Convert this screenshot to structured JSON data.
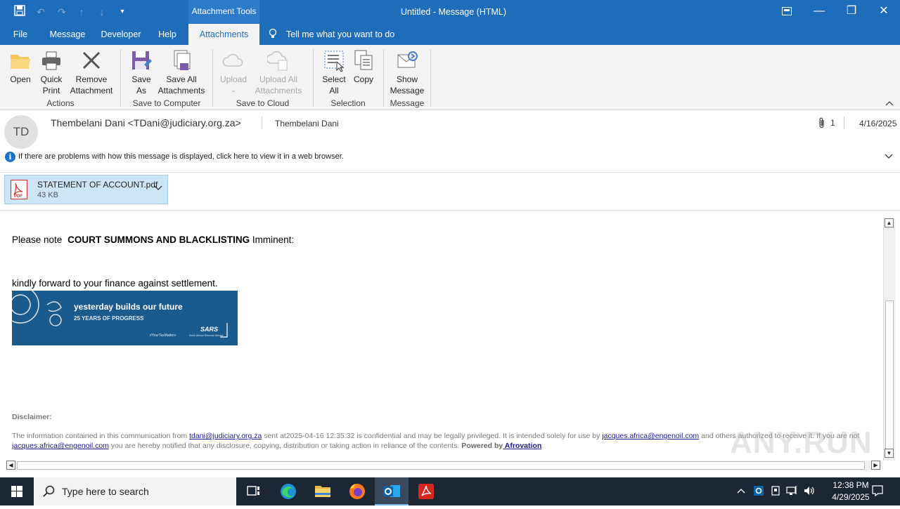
{
  "window": {
    "title": "Untitled  -  Message (HTML)",
    "context_tab_header": "Attachment Tools"
  },
  "menu": {
    "tabs": [
      {
        "label": "File"
      },
      {
        "label": "Message"
      },
      {
        "label": "Developer"
      },
      {
        "label": "Help"
      },
      {
        "label": "Attachments"
      }
    ],
    "tell_me": "Tell me what you want to do"
  },
  "ribbon": {
    "open": "Open",
    "quick_print": [
      "Quick",
      "Print"
    ],
    "remove_attachment": [
      "Remove",
      "Attachment"
    ],
    "group_actions": "Actions",
    "save_as": [
      "Save",
      "As"
    ],
    "save_all": [
      "Save All",
      "Attachments"
    ],
    "group_save_computer": "Save to Computer",
    "upload": "Upload",
    "upload_all": [
      "Upload All",
      "Attachments"
    ],
    "group_save_cloud": "Save to Cloud",
    "select_all": [
      "Select",
      "All"
    ],
    "copy": "Copy",
    "group_selection": "Selection",
    "show_message": [
      "Show",
      "Message"
    ],
    "group_message": "Message"
  },
  "header": {
    "avatar_initials": "TD",
    "sender": "Thembelani Dani <TDani@judiciary.org.za>",
    "recipient": "Thembelani Dani",
    "attachment_count": "1",
    "date": "4/16/2025",
    "info_text": "If there are problems with how this message is displayed, click here to view it in a web browser."
  },
  "attachment": {
    "name": "STATEMENT OF ACCOUNT.pdf",
    "size": "43 KB"
  },
  "body": {
    "line1_prefix": "Please note",
    "line1_bold": "COURT SUMMONS AND BLACKLISTING",
    "line1_suffix": "Imminent:",
    "line2": "kindly forward to your finance against settlement.",
    "banner": {
      "headline": "yesterday builds our future",
      "sub": "25 YEARS OF PROGRESS",
      "hashtag": "#YourTaxMatters",
      "brand": "SARS",
      "brand_sub": "South African Revenue Service"
    },
    "disclaimer_title": "Disclaimer:",
    "disclaimer": {
      "t1": "The information contained in this communication from ",
      "link1": "tdani@judiciary.org.za",
      "t2": " sent at2025-04-16 12:35:32 is confidential and may be legally privileged. It is intended solely for use by ",
      "link2": "jacques.africa@engenoil.com",
      "t3": " and others authorized to receive it. If you are not ",
      "link3": "jacques.africa@engenoil.com",
      "t4": " you are hereby notified that any disclosure, copying, distribution or taking action in reliance of the contents. ",
      "powered": "Powered by",
      "link4": " Afrovation"
    }
  },
  "watermark": "ANY.RUN",
  "taskbar": {
    "search_placeholder": "Type here to search",
    "time": "12:38 PM",
    "date": "4/29/2025"
  },
  "colors": {
    "titlebar": "#1e6dba",
    "ribbon_bg": "#f3f3f3",
    "attachment_bg": "#cde6f7",
    "taskbar": "#1c2733",
    "banner": "#1b5a8c"
  }
}
